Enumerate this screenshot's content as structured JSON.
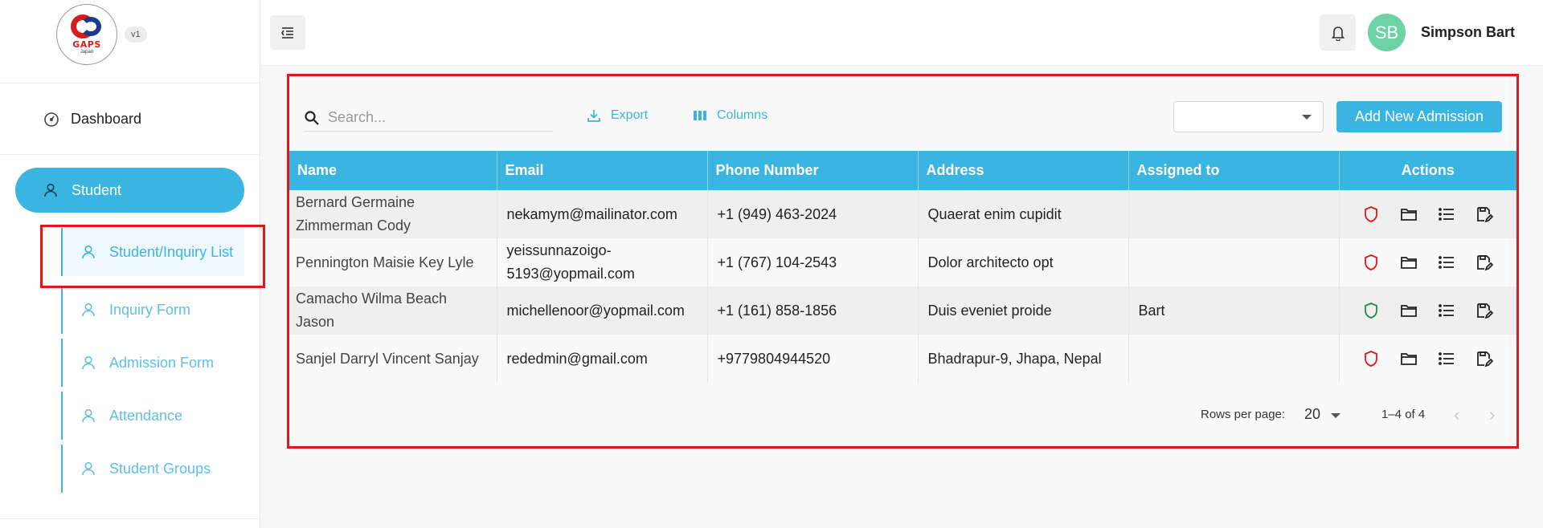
{
  "brand": {
    "logo_text": "GAPS",
    "logo_sub": "Japan",
    "version": "v1"
  },
  "sidebar": {
    "dashboard_label": "Dashboard",
    "student_label": "Student",
    "sub_items": [
      {
        "label": "Student/Inquiry List",
        "icon": "user-icon",
        "active": true
      },
      {
        "label": "Inquiry Form",
        "icon": "user-icon"
      },
      {
        "label": "Admission Form",
        "icon": "user-icon"
      },
      {
        "label": "Attendance",
        "icon": "user-icon"
      },
      {
        "label": "Student Groups",
        "icon": "user-icon"
      }
    ]
  },
  "header": {
    "avatar_initials": "SB",
    "user_name": "Simpson Bart"
  },
  "toolbar": {
    "search_placeholder": "Search...",
    "export_label": "Export",
    "columns_label": "Columns",
    "select_value": "",
    "add_label": "Add New Admission"
  },
  "table": {
    "headers": [
      "Name",
      "Email",
      "Phone Number",
      "Address",
      "Assigned to",
      "Actions"
    ],
    "rows": [
      {
        "name": "Bernard Germaine Zimmerman Cody",
        "email": "nekamym@mailinator.com",
        "phone": "+1 (949) 463-2024",
        "address": "Quaerat enim cupidit",
        "assigned": "",
        "shield_color": "#e01818"
      },
      {
        "name": "Pennington Maisie Key Lyle",
        "email": "yeissunnazoigo-5193@yopmail.com",
        "phone": "+1 (767) 104-2543",
        "address": "Dolor architecto opt",
        "assigned": "",
        "shield_color": "#e01818"
      },
      {
        "name": "Camacho Wilma Beach Jason",
        "email": "michellenoor@yopmail.com",
        "phone": "+1 (161) 858-1856",
        "address": "Duis eveniet proide",
        "assigned": "Bart",
        "shield_color": "#1e8c4a"
      },
      {
        "name": "Sanjel Darryl Vincent Sanjay",
        "email": "rededmin@gmail.com",
        "phone": "+9779804944520",
        "address": "Bhadrapur-9, Jhapa, Nepal",
        "assigned": "",
        "shield_color": "#e01818"
      }
    ]
  },
  "pagination": {
    "rows_per_page_label": "Rows per page:",
    "rows_per_page": "20",
    "range": "1–4 of 4",
    "prev": "‹",
    "next": "›"
  },
  "colors": {
    "accent": "#3ab4e0",
    "highlight": "#e01818"
  }
}
